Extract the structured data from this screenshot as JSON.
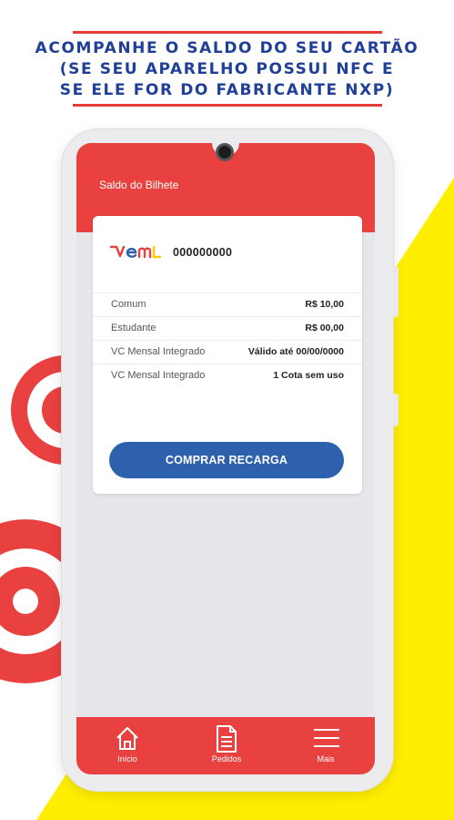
{
  "promo": {
    "line1": "ACOMPANHE O SALDO DO SEU CARTÃO",
    "line2": "(SE SEU APARELHO POSSUI NFC E",
    "line3": "SE ELE FOR DO FABRICANTE NXP)"
  },
  "colors": {
    "brand_red": "#e84140",
    "brand_blue": "#2e61ad",
    "headline_blue": "#1f3f99",
    "accent_yellow": "#ffee00"
  },
  "app": {
    "header_title": "Saldo do Bilhete",
    "card": {
      "logo": "vem",
      "number": "000000000",
      "rows": [
        {
          "label": "Comum",
          "value": "R$ 10,00"
        },
        {
          "label": "Estudante",
          "value": "R$ 00,00"
        },
        {
          "label": "VC Mensal Integrado",
          "value": "Válido até 00/00/0000"
        },
        {
          "label": "VC Mensal Integrado",
          "value": "1 Cota sem uso"
        }
      ],
      "buy_button": "COMPRAR RECARGA"
    },
    "nav": [
      {
        "label": "Início",
        "icon": "home-icon"
      },
      {
        "label": "Pedidos",
        "icon": "document-icon"
      },
      {
        "label": "Mais",
        "icon": "menu-icon"
      }
    ]
  }
}
